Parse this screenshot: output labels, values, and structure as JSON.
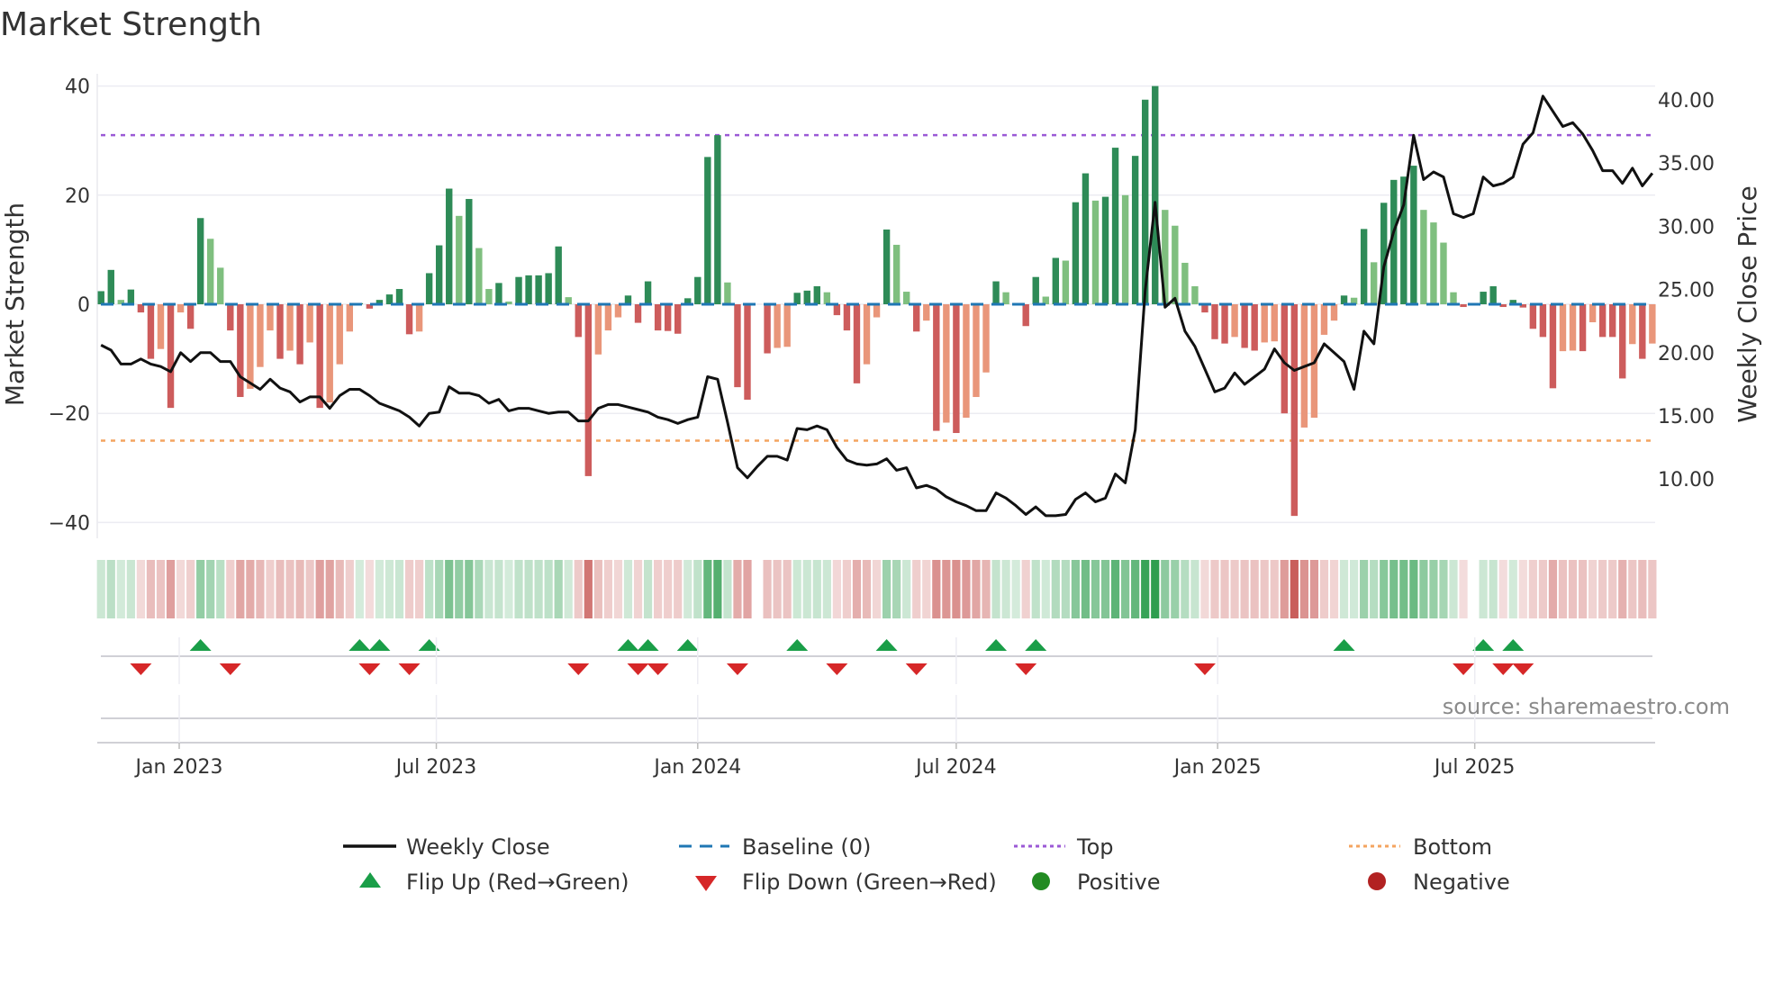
{
  "chart_data": {
    "type": "bar",
    "title": "Market Strength",
    "ylabel": "Market Strength",
    "y2label": "Weekly Close Price",
    "ylim": [
      -42,
      42
    ],
    "y2lim": [
      6.5,
      41.5
    ],
    "yticks": [
      "40",
      "20",
      "0",
      "−20",
      "−40"
    ],
    "ytick_values": [
      40,
      20,
      0,
      -20,
      -40
    ],
    "y2ticks": [
      "40.00",
      "35.00",
      "30.00",
      "25.00",
      "20.00",
      "15.00",
      "10.00"
    ],
    "y2tick_values": [
      40,
      35,
      30,
      25,
      20,
      15,
      10
    ],
    "xticks": [
      {
        "label": "Jan 2023",
        "date": "2023-01-01"
      },
      {
        "label": "Jul 2023",
        "date": "2023-07-01"
      },
      {
        "label": "Jan 2024",
        "date": "2024-01-01"
      },
      {
        "label": "Jul 2024",
        "date": "2024-07-01"
      },
      {
        "label": "Jan 2025",
        "date": "2025-01-01"
      },
      {
        "label": "Jul 2025",
        "date": "2025-07-01"
      }
    ],
    "start_date": "2022-11-07",
    "frequency": "weekly",
    "grid": true,
    "top_level": 31,
    "bottom_level": -25,
    "baseline": 0,
    "strength": [
      2.4,
      6.3,
      0.8,
      2.7,
      -1.5,
      -10,
      -8.2,
      -19,
      -1.5,
      -4.5,
      15.8,
      12,
      6.7,
      -4.8,
      -17,
      -15.5,
      -11.5,
      -4.8,
      -10,
      -8.5,
      -11,
      -7,
      -19,
      -18,
      -11,
      -5,
      0.2,
      -0.8,
      0.8,
      1.8,
      2.8,
      -5.5,
      -5,
      5.7,
      10.8,
      21.2,
      16.2,
      19.3,
      10.3,
      2.8,
      3.9,
      0.5,
      5,
      5.3,
      5.3,
      5.7,
      10.6,
      1.3,
      -6,
      -31.5,
      -9.2,
      -4.8,
      -2.4,
      1.6,
      -3.4,
      4.2,
      -4.8,
      -4.9,
      -5.4,
      1.1,
      5,
      27,
      31,
      4,
      -15.2,
      -17.5,
      0,
      -9,
      -8,
      -7.8,
      2.1,
      2.5,
      3.3,
      2.2,
      -2,
      -4.8,
      -14.5,
      -11,
      -2.4,
      13.7,
      10.9,
      2.3,
      -5,
      -3,
      -23.2,
      -21.7,
      -23.6,
      -20.8,
      -17,
      -12.5,
      4.2,
      2.2,
      0.2,
      -4,
      5,
      1.4,
      8.5,
      8,
      18.7,
      24,
      19,
      19.7,
      28.7,
      20,
      27.2,
      37.5,
      40,
      17.3,
      14.4,
      7.6,
      3.3,
      -1.5,
      -6.4,
      -7.2,
      -6,
      -8,
      -8.5,
      -7,
      -6.8,
      -20,
      -38.8,
      -22.6,
      -20.8,
      -5.6,
      -3,
      1.6,
      1.2,
      13.8,
      7.7,
      18.6,
      22.8,
      23.4,
      25.4,
      17.3,
      15,
      11.3,
      2.2,
      -0.5,
      0,
      2.3,
      3.3,
      -0.5,
      0.8,
      -0.6,
      -4.5,
      -6,
      -15.4,
      -8.6,
      -8.5,
      -8.6,
      -3.3,
      -6,
      -6,
      -13.6,
      -7.3,
      -10,
      -7.2
    ],
    "weekly_close": [
      20.6,
      20.2,
      19.1,
      19.1,
      19.5,
      19.1,
      18.9,
      18.5,
      20.0,
      19.3,
      20.0,
      20.0,
      19.3,
      19.3,
      18.1,
      17.6,
      17.1,
      17.9,
      17.2,
      16.9,
      16.1,
      16.5,
      16.5,
      15.6,
      16.6,
      17.1,
      17.1,
      16.6,
      16.0,
      15.7,
      15.4,
      14.9,
      14.2,
      15.2,
      15.3,
      17.3,
      16.8,
      16.8,
      16.6,
      16.0,
      16.3,
      15.4,
      15.6,
      15.6,
      15.4,
      15.2,
      15.3,
      15.3,
      14.6,
      14.6,
      15.6,
      15.9,
      15.9,
      15.7,
      15.5,
      15.3,
      14.9,
      14.7,
      14.4,
      14.7,
      14.9,
      18.1,
      17.9,
      14.5,
      10.9,
      10.1,
      11.0,
      11.8,
      11.8,
      11.5,
      14.0,
      13.9,
      14.2,
      13.9,
      12.5,
      11.5,
      11.2,
      11.1,
      11.2,
      11.6,
      10.7,
      10.9,
      9.3,
      9.5,
      9.2,
      8.6,
      8.2,
      7.9,
      7.5,
      7.5,
      8.9,
      8.5,
      7.9,
      7.2,
      7.8,
      7.1,
      7.1,
      7.2,
      8.4,
      8.9,
      8.2,
      8.5,
      10.4,
      9.7,
      13.9,
      24.9,
      31.9,
      23.6,
      24.3,
      21.7,
      20.5,
      18.7,
      16.9,
      17.2,
      18.4,
      17.5,
      18.1,
      18.7,
      20.3,
      19.2,
      18.6,
      18.9,
      19.2,
      20.7,
      20.0,
      19.3,
      17.1,
      21.7,
      20.7,
      26.8,
      29.6,
      31.7,
      37.2,
      33.7,
      34.3,
      33.9,
      31.0,
      30.7,
      31.0,
      33.9,
      33.2,
      33.4,
      33.9,
      36.5,
      37.4,
      40.3,
      39.1,
      37.9,
      38.2,
      37.3,
      36.0,
      34.4,
      34.4,
      33.4,
      34.6,
      33.2,
      34.2
    ],
    "legend": {
      "placement": "bottom",
      "entries": [
        {
          "label": "Weekly Close",
          "symbol": "solid-line",
          "color": "#111111"
        },
        {
          "label": "Baseline (0)",
          "symbol": "dashed-line",
          "color": "#1f77b4"
        },
        {
          "label": "Top",
          "symbol": "dotted-line",
          "color": "#9b59d6"
        },
        {
          "label": "Bottom",
          "symbol": "dotted-line",
          "color": "#f4a460"
        },
        {
          "label": "Flip Up (Red→Green)",
          "symbol": "triangle-up",
          "color": "#1a9e48"
        },
        {
          "label": "Flip Down (Green→Red)",
          "symbol": "triangle-down",
          "color": "#d62728"
        },
        {
          "label": "Positive",
          "symbol": "circle",
          "color": "#228b22"
        },
        {
          "label": "Negative",
          "symbol": "circle",
          "color": "#b22222"
        }
      ]
    },
    "colors": {
      "pos_rising": "#2e8b57",
      "pos_falling": "#7fbf7f",
      "neg_falling": "#cd5c5c",
      "neg_rising": "#e9967a",
      "strip_pos": "#2e9e4f",
      "strip_neg": "#c85a57",
      "line": "#111111"
    },
    "source": "source: sharemaestro.com"
  }
}
